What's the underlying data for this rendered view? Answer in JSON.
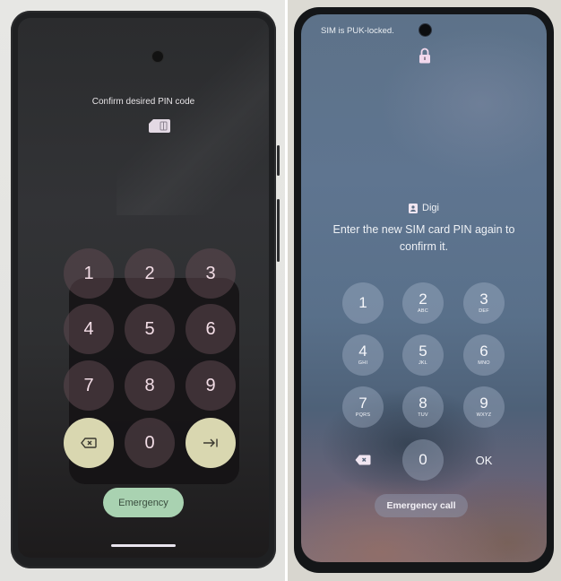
{
  "left_phone": {
    "title": "Confirm desired PIN code",
    "icons": {
      "sim": "sim-card-icon",
      "backspace": "backspace-icon",
      "enter": "enter-arrow-icon"
    },
    "keys": [
      "1",
      "2",
      "3",
      "4",
      "5",
      "6",
      "7",
      "8",
      "9"
    ],
    "zero": "0",
    "emergency_label": "Emergency",
    "colors": {
      "key_bg": "#5f4850",
      "action_key_bg": "#d9d7b0",
      "emergency_bg": "#a9d2b1"
    }
  },
  "right_phone": {
    "status_text": "SIM is PUK-locked.",
    "icons": {
      "lock": "lock-icon",
      "carrier": "sim-contact-icon",
      "backspace": "backspace-icon"
    },
    "carrier_name": "Digi",
    "message": "Enter the new SIM card PIN again to confirm it.",
    "keys": [
      {
        "num": "1",
        "letters": ""
      },
      {
        "num": "2",
        "letters": "ABC"
      },
      {
        "num": "3",
        "letters": "DEF"
      },
      {
        "num": "4",
        "letters": "GHI"
      },
      {
        "num": "5",
        "letters": "JKL"
      },
      {
        "num": "6",
        "letters": "MNO"
      },
      {
        "num": "7",
        "letters": "PQRS"
      },
      {
        "num": "8",
        "letters": "TUV"
      },
      {
        "num": "9",
        "letters": "WXYZ"
      }
    ],
    "zero": "0",
    "ok_label": "OK",
    "emergency_label": "Emergency call",
    "colors": {
      "key_bg": "#aab9cd",
      "lock": "#f2d8ec"
    }
  }
}
